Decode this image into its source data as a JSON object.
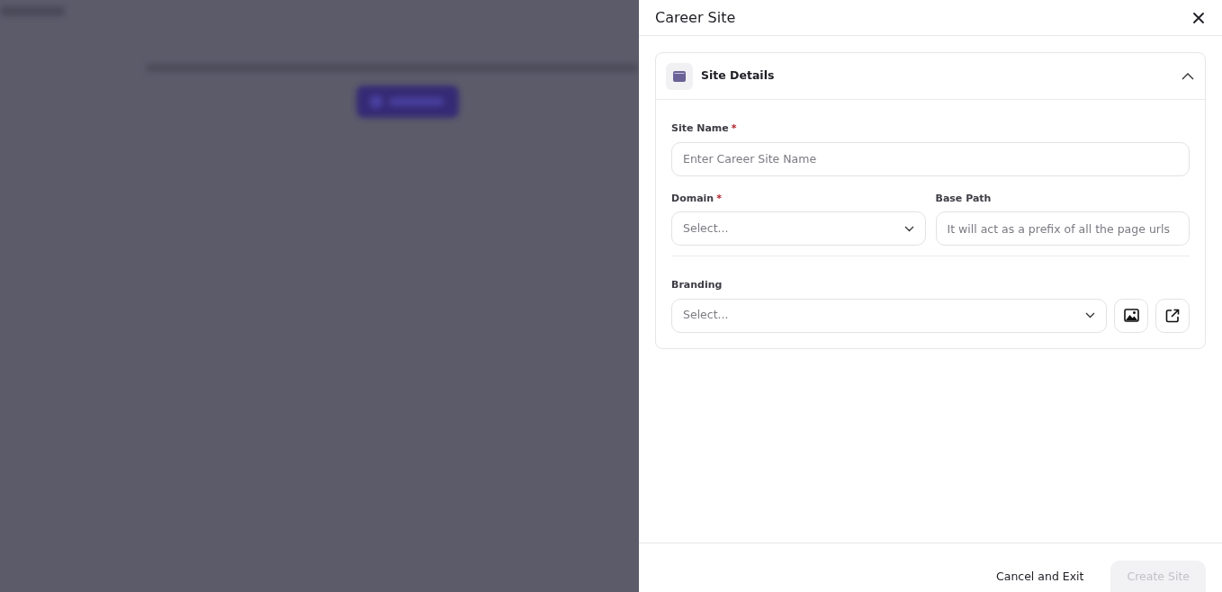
{
  "drawer": {
    "title": "Career Site"
  },
  "section": {
    "title": "Site Details",
    "expanded": true
  },
  "rows": [
    [
      {
        "kind": "text",
        "label": "Site Name",
        "required_mark": "*",
        "placeholder": "Enter Career Site Name"
      }
    ],
    [
      {
        "kind": "select",
        "label": "Domain",
        "required_mark": "*",
        "placeholder": "Select..."
      },
      {
        "kind": "text",
        "label": "Base Path",
        "placeholder": "It will act as a prefix of all the page urls"
      }
    ],
    [
      {
        "kind": "select-actions",
        "label": "Branding",
        "placeholder": "Select..."
      }
    ]
  ],
  "footer": [
    {
      "label": "Cancel and Exit",
      "kind": "link",
      "disabled": false
    },
    {
      "label": "Create Site",
      "kind": "primary",
      "disabled": true
    }
  ]
}
